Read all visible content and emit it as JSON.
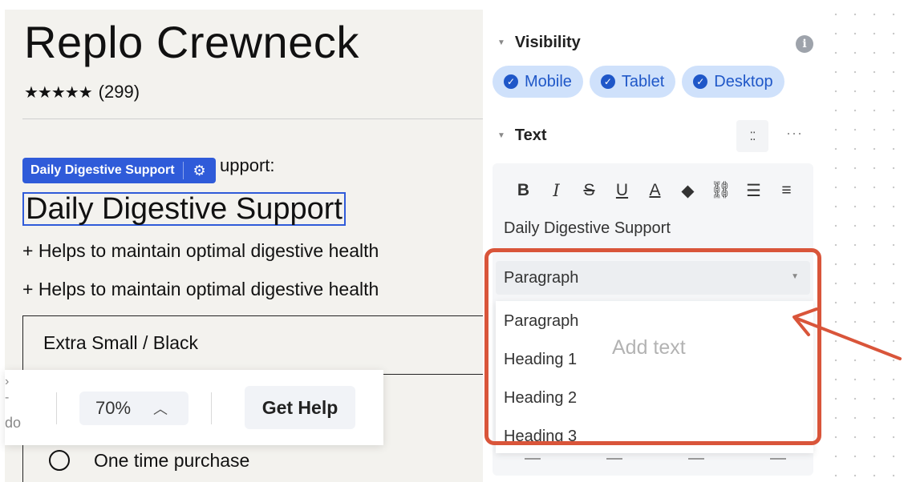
{
  "canvas": {
    "product_title": "Replo Crewneck",
    "rating_stars": "★★★★★",
    "rating_count": "(299)",
    "partial_heading": "upport:",
    "selection_badge_label": "Daily Digestive Support",
    "selected_heading": "Daily Digestive Support",
    "benefits": [
      "+ Helps to maintain optimal digestive health",
      "+ Helps to maintain optimal digestive health"
    ],
    "variant_label": "Extra Small / Black",
    "purchase_option": "One time purchase"
  },
  "floating_toolbar": {
    "edge_text": "do",
    "zoom_value": "70%",
    "get_help_label": "Get Help"
  },
  "panel": {
    "visibility": {
      "title": "Visibility",
      "info_glyph": "i",
      "chips": [
        "Mobile",
        "Tablet",
        "Desktop"
      ]
    },
    "text_section": {
      "title": "Text",
      "more_glyph": "···",
      "editor_text": "Daily Digestive Support",
      "selected_style": "Paragraph",
      "dropdown_options": [
        "Paragraph",
        "Heading 1",
        "Heading 2",
        "Heading 3"
      ],
      "placeholder": "Add text"
    }
  },
  "annotation": {
    "color": "#d9553a"
  },
  "colors": {
    "accent_blue": "#2f5bd9",
    "chip_bg": "#cfe1fb",
    "chip_text": "#1f57c8",
    "canvas_bg": "#f3f2ee"
  }
}
